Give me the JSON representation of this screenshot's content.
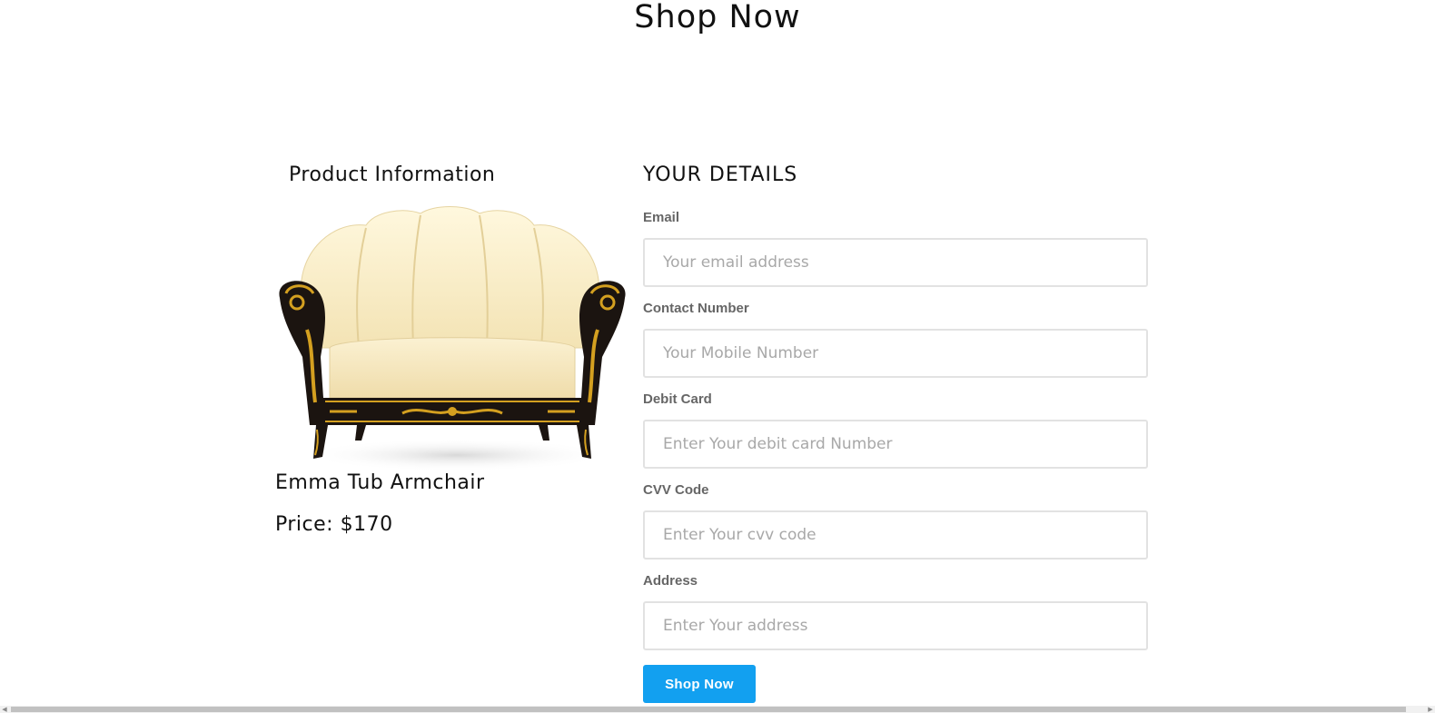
{
  "page": {
    "title": "Shop Now"
  },
  "product": {
    "heading": "Product Information",
    "name": "Emma Tub Armchair",
    "price": "Price: $170",
    "image_icon": "armchair-image"
  },
  "form": {
    "heading": "YOUR DETAILS",
    "fields": [
      {
        "label": "Email",
        "placeholder": "Your email address",
        "value": ""
      },
      {
        "label": "Contact Number",
        "placeholder": "Your Mobile Number",
        "value": ""
      },
      {
        "label": "Debit Card",
        "placeholder": "Enter Your debit card Number",
        "value": ""
      },
      {
        "label": "CVV Code",
        "placeholder": "Enter Your cvv code",
        "value": ""
      },
      {
        "label": "Address",
        "placeholder": "Enter Your address",
        "value": ""
      }
    ],
    "submit_label": "Shop Now"
  },
  "colors": {
    "accent": "#12a0f0",
    "label_gray": "#666666",
    "input_border": "#e2e2e2",
    "chair_cushion": "#fbf0cf",
    "chair_frame": "#1b1410",
    "chair_gold": "#d4a020"
  },
  "scrollbar": {
    "left_arrow_icon": "scroll-left-icon",
    "right_arrow_icon": "scroll-right-icon"
  }
}
